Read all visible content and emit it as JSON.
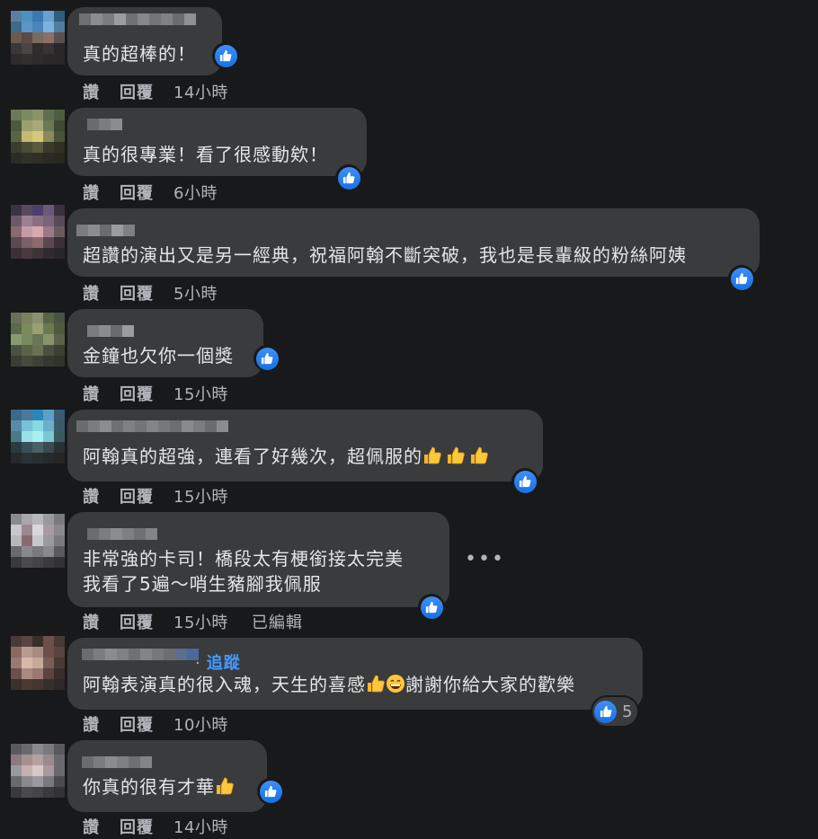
{
  "comments": [
    {
      "text_lines": [
        "真的超棒的！"
      ],
      "actions": {
        "like": "讚",
        "reply": "回覆",
        "time": "14小時"
      },
      "avatar_colors": [
        "#5c7fa0",
        "#4d8fc0",
        "#3b7ab0",
        "#6aa0d0",
        "#2e5d80",
        "#3d6a8a",
        "#5a96c8",
        "#4a84b8",
        "#7ab2e0",
        "#4f7e9e",
        "#6b5a50",
        "#5a4a48",
        "#7a6a60",
        "#8a7066",
        "#5a5050",
        "#3a3838",
        "#4a4444",
        "#2f2c2c",
        "#3a3333",
        "#2a2727",
        "#2c2a2a",
        "#332f2f",
        "#2d2b2b",
        "#2a2828",
        "#292727"
      ],
      "name_colors": [
        "#6d6f72",
        "#8a8c8f",
        "#7a7c7f",
        "#9a9c9f",
        "#6f7174",
        "#858789",
        "#737577",
        "#7f8183",
        "#6a6c6e",
        "#8e9093"
      ]
    },
    {
      "text_lines": [
        "真的很專業！看了很感動欸！"
      ],
      "actions": {
        "like": "讚",
        "reply": "回覆",
        "time": "6小時"
      },
      "avatar_colors": [
        "#6a7a58",
        "#7b8a60",
        "#8a9468",
        "#5f6f4c",
        "#4e5e40",
        "#4a5a3a",
        "#9aa070",
        "#a8a878",
        "#6a7a52",
        "#3e4a32",
        "#5a6444",
        "#c8b870",
        "#d8c878",
        "#8a8a5a",
        "#4a5234",
        "#3a3e2e",
        "#4a4e36",
        "#5a5a3e",
        "#3a3a2c",
        "#303026",
        "#2c2c26",
        "#32322a",
        "#2e2e26",
        "#2a2a24",
        "#28281f"
      ],
      "name_colors": [
        "#6a6c6e",
        "#7a7c7e",
        "#8a8c8e"
      ]
    },
    {
      "text_lines": [
        "超讚的演出又是另一經典，祝福阿翰不斷突破，我也是長輩級的粉絲阿姨"
      ],
      "actions": {
        "like": "讚",
        "reply": "回覆",
        "time": "5小時"
      },
      "avatar_colors": [
        "#3a3440",
        "#5a4a5e",
        "#4a3e70",
        "#6a5a7a",
        "#3a3040",
        "#6a5a68",
        "#9a8090",
        "#8a7080",
        "#7a6478",
        "#5a4a58",
        "#8a6a70",
        "#c89aa8",
        "#d8a8b0",
        "#9a7a88",
        "#6a5a60",
        "#5a4a50",
        "#7a6068",
        "#8a6a70",
        "#5a4850",
        "#3a3036",
        "#3a3034",
        "#4a3a40",
        "#3e3438",
        "#302a2e",
        "#2a2628"
      ],
      "name_colors": [
        "#7a7c7e",
        "#8a8c8e",
        "#6a6c6e",
        "#9a9c9e",
        "#7e8082"
      ]
    },
    {
      "text_lines": [
        "金鐘也欠你一個獎"
      ],
      "actions": {
        "like": "讚",
        "reply": "回覆",
        "time": "15小時"
      },
      "avatar_colors": [
        "#6a7058",
        "#7a8060",
        "#8a9070",
        "#5a6448",
        "#4a5440",
        "#5a6a48",
        "#7a8a5a",
        "#9aa070",
        "#6a7a50",
        "#4e5a3e",
        "#8a9a70",
        "#7a8a60",
        "#6a7458",
        "#8a9468",
        "#5a6448",
        "#4a5240",
        "#5a6248",
        "#6a7050",
        "#4a5040",
        "#3a4032",
        "#3a3e32",
        "#464a3c",
        "#3e4236",
        "#34382e",
        "#30332a"
      ],
      "name_colors": [
        "#7a7c7e",
        "#8a8c8e",
        "#6a6c6e",
        "#9a9c9e"
      ]
    },
    {
      "text_lines": [
        "阿翰真的超強，連看了好幾次，超佩服的"
      ],
      "thumbs": 3,
      "actions": {
        "like": "讚",
        "reply": "回覆",
        "time": "15小時"
      },
      "avatar_colors": [
        "#3a6a8a",
        "#4a7a9a",
        "#2a88b8",
        "#5aa0c8",
        "#3a5a70",
        "#5a8aa8",
        "#7ac0d8",
        "#8ad8e0",
        "#6ab0c8",
        "#3a5a6a",
        "#4a7a88",
        "#9ae0e8",
        "#a8f0f0",
        "#7ac8d0",
        "#3a5860",
        "#2a3a40",
        "#3a5058",
        "#4a6068",
        "#3a4a50",
        "#2a3034",
        "#262a2c",
        "#2c3236",
        "#2a2e30",
        "#262a2c",
        "#242628"
      ],
      "name_colors": [
        "#6a6c6e",
        "#7a7c7e",
        "#8a8c8e",
        "#6e7072",
        "#7e8082",
        "#727476",
        "#828486",
        "#767879",
        "#6c6e70",
        "#888a8c",
        "#7a7c7e",
        "#6a6c6e",
        "#8a8c8e"
      ]
    },
    {
      "text_lines": [
        "非常強的卡司！橋段太有梗銜接太完美",
        "我看了5遍～哨生豬腳我佩服"
      ],
      "actions": {
        "like": "讚",
        "reply": "回覆",
        "time": "15小時",
        "edited": "已編輯"
      },
      "avatar_colors": [
        "#8a8a8e",
        "#a8a8ac",
        "#b8b8bc",
        "#9a9a9e",
        "#7a7a7e",
        "#c8c8cc",
        "#9a8a90",
        "#d8d8dc",
        "#a89aa0",
        "#8a8a8e",
        "#b8b8bc",
        "#8a6a70",
        "#c8c8cc",
        "#9a9aa0",
        "#7a7a7e",
        "#6a6a6e",
        "#8a8a8e",
        "#7a7a7e",
        "#8a8a8e",
        "#5a5a5e",
        "#3a3a3e",
        "#4a4a4e",
        "#444448",
        "#3a3a3e",
        "#333336"
      ],
      "name_colors": [
        "#6a6c6e",
        "#7a7c7e",
        "#8a8c8e",
        "#7e8082",
        "#6e7072",
        "#828486"
      ]
    },
    {
      "text_lines": [
        "阿翰表演真的很入魂，天生的喜感",
        "謝謝你給大家的歡樂"
      ],
      "follow": "追蹤",
      "like_count": "5",
      "actions": {
        "like": "讚",
        "reply": "回覆",
        "time": "10小時"
      },
      "avatar_colors": [
        "#4a3a36",
        "#5a4440",
        "#3a2e2a",
        "#6a5048",
        "#4a3a34",
        "#8a6a60",
        "#b89a90",
        "#a88a80",
        "#6a5048",
        "#5a4440",
        "#9a7a70",
        "#d8b8a8",
        "#c8a898",
        "#7a5e54",
        "#4a3a34",
        "#6a5048",
        "#a88a80",
        "#9a7a70",
        "#5a4440",
        "#3a2e2a",
        "#3a302c",
        "#4a3a34",
        "#443632",
        "#36302c",
        "#2e2826"
      ],
      "name_colors": [
        "#6a6c6e",
        "#7a7c7e",
        "#8a8c8e",
        "#7e8082",
        "#6e7072",
        "#828486",
        "#767879",
        "#6c6e70",
        "#5a6e90",
        "#4a6a98"
      ]
    },
    {
      "text_lines": [
        "你真的很有才華"
      ],
      "thumbs": 1,
      "actions": {
        "like": "讚",
        "reply": "回覆",
        "time": "14小時"
      },
      "avatar_colors": [
        "#5a5a5e",
        "#6a6a6e",
        "#8a8a8e",
        "#7a7a7e",
        "#5a5a5e",
        "#8a7a7e",
        "#a89090",
        "#b8a0a0",
        "#9a8a8e",
        "#6a6a6e",
        "#9a9a9e",
        "#c8b0b0",
        "#d8c8c8",
        "#a89a9e",
        "#6a6a6e",
        "#6a6a6e",
        "#8a8a8e",
        "#9a9a9e",
        "#7a7a7e",
        "#4a4a4e",
        "#3a3a3e",
        "#4a4a4e",
        "#444448",
        "#3a3a3e",
        "#333336"
      ],
      "name_colors": [
        "#6a6c6e",
        "#7a7c7e",
        "#8a8c8e",
        "#7e8082",
        "#6e7072",
        "#828486"
      ]
    }
  ]
}
